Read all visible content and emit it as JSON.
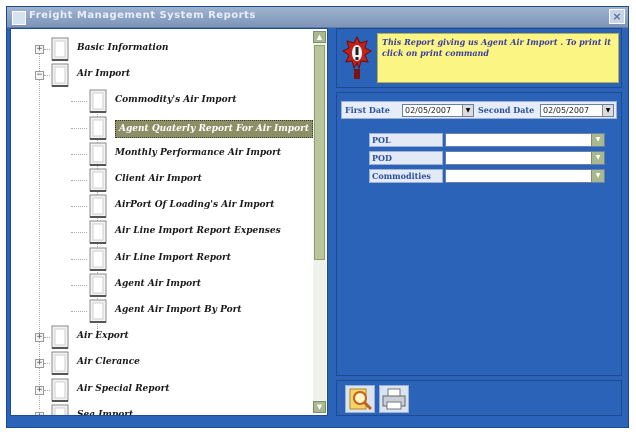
{
  "window": {
    "title": "Freight Management System Reports",
    "close_glyph": "×"
  },
  "tree": {
    "items": [
      {
        "label": "Basic Information",
        "level": 0,
        "expander": "+"
      },
      {
        "label": "Air Import",
        "level": 0,
        "expander": "−"
      },
      {
        "label": "Commodity's Air Import",
        "level": 1
      },
      {
        "label": "Agent Quaterly Report For Air Import",
        "level": 1,
        "selected": true
      },
      {
        "label": "Monthly Performance Air Import",
        "level": 1
      },
      {
        "label": "Client Air Import",
        "level": 1
      },
      {
        "label": "AirPort Of Loading's Air Import",
        "level": 1
      },
      {
        "label": "Air Line Import Report Expenses",
        "level": 1
      },
      {
        "label": "Air Line Import Report",
        "level": 1
      },
      {
        "label": "Agent Air Import",
        "level": 1
      },
      {
        "label": "Agent Air Import By Port",
        "level": 1
      },
      {
        "label": "Air Export",
        "level": 0,
        "expander": "+"
      },
      {
        "label": "Air Clerance",
        "level": 0,
        "expander": "+"
      },
      {
        "label": "Air Special Report",
        "level": 0,
        "expander": "+"
      },
      {
        "label": "Sea Import",
        "level": 0,
        "expander": "+"
      }
    ],
    "scroll_up_glyph": "▲",
    "scroll_down_glyph": "▼"
  },
  "info": {
    "message": "This Report giving us Agent Air Import . To print it click on print command",
    "icon": "exclamation-icon"
  },
  "filters": {
    "first_date_label": "First Date",
    "first_date_value": "02/05/2007",
    "second_date_label": "Second Date",
    "second_date_value": "02/05/2007",
    "dropdown_glyph": "▼",
    "fields": [
      {
        "label": "POL",
        "value": ""
      },
      {
        "label": "POD",
        "value": ""
      },
      {
        "label": "Commodities",
        "value": ""
      }
    ]
  },
  "toolbar": {
    "buttons": [
      {
        "icon": "preview-search-icon"
      },
      {
        "icon": "printer-icon"
      }
    ]
  },
  "colors": {
    "window_bg": "#2a63b8",
    "selected_bg": "#8a8f66",
    "info_bg": "#fbf583"
  }
}
